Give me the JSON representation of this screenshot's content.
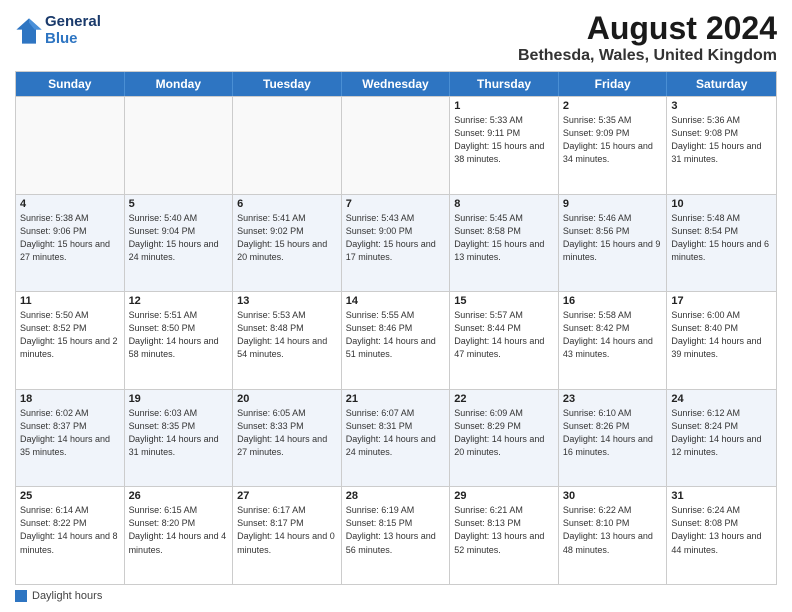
{
  "header": {
    "logo_line1": "General",
    "logo_line2": "Blue",
    "main_title": "August 2024",
    "subtitle": "Bethesda, Wales, United Kingdom"
  },
  "calendar": {
    "days_of_week": [
      "Sunday",
      "Monday",
      "Tuesday",
      "Wednesday",
      "Thursday",
      "Friday",
      "Saturday"
    ],
    "weeks": [
      [
        {
          "day": "",
          "empty": true
        },
        {
          "day": "",
          "empty": true
        },
        {
          "day": "",
          "empty": true
        },
        {
          "day": "",
          "empty": true
        },
        {
          "day": "1",
          "sunrise": "Sunrise: 5:33 AM",
          "sunset": "Sunset: 9:11 PM",
          "daylight": "Daylight: 15 hours and 38 minutes."
        },
        {
          "day": "2",
          "sunrise": "Sunrise: 5:35 AM",
          "sunset": "Sunset: 9:09 PM",
          "daylight": "Daylight: 15 hours and 34 minutes."
        },
        {
          "day": "3",
          "sunrise": "Sunrise: 5:36 AM",
          "sunset": "Sunset: 9:08 PM",
          "daylight": "Daylight: 15 hours and 31 minutes."
        }
      ],
      [
        {
          "day": "4",
          "sunrise": "Sunrise: 5:38 AM",
          "sunset": "Sunset: 9:06 PM",
          "daylight": "Daylight: 15 hours and 27 minutes."
        },
        {
          "day": "5",
          "sunrise": "Sunrise: 5:40 AM",
          "sunset": "Sunset: 9:04 PM",
          "daylight": "Daylight: 15 hours and 24 minutes."
        },
        {
          "day": "6",
          "sunrise": "Sunrise: 5:41 AM",
          "sunset": "Sunset: 9:02 PM",
          "daylight": "Daylight: 15 hours and 20 minutes."
        },
        {
          "day": "7",
          "sunrise": "Sunrise: 5:43 AM",
          "sunset": "Sunset: 9:00 PM",
          "daylight": "Daylight: 15 hours and 17 minutes."
        },
        {
          "day": "8",
          "sunrise": "Sunrise: 5:45 AM",
          "sunset": "Sunset: 8:58 PM",
          "daylight": "Daylight: 15 hours and 13 minutes."
        },
        {
          "day": "9",
          "sunrise": "Sunrise: 5:46 AM",
          "sunset": "Sunset: 8:56 PM",
          "daylight": "Daylight: 15 hours and 9 minutes."
        },
        {
          "day": "10",
          "sunrise": "Sunrise: 5:48 AM",
          "sunset": "Sunset: 8:54 PM",
          "daylight": "Daylight: 15 hours and 6 minutes."
        }
      ],
      [
        {
          "day": "11",
          "sunrise": "Sunrise: 5:50 AM",
          "sunset": "Sunset: 8:52 PM",
          "daylight": "Daylight: 15 hours and 2 minutes."
        },
        {
          "day": "12",
          "sunrise": "Sunrise: 5:51 AM",
          "sunset": "Sunset: 8:50 PM",
          "daylight": "Daylight: 14 hours and 58 minutes."
        },
        {
          "day": "13",
          "sunrise": "Sunrise: 5:53 AM",
          "sunset": "Sunset: 8:48 PM",
          "daylight": "Daylight: 14 hours and 54 minutes."
        },
        {
          "day": "14",
          "sunrise": "Sunrise: 5:55 AM",
          "sunset": "Sunset: 8:46 PM",
          "daylight": "Daylight: 14 hours and 51 minutes."
        },
        {
          "day": "15",
          "sunrise": "Sunrise: 5:57 AM",
          "sunset": "Sunset: 8:44 PM",
          "daylight": "Daylight: 14 hours and 47 minutes."
        },
        {
          "day": "16",
          "sunrise": "Sunrise: 5:58 AM",
          "sunset": "Sunset: 8:42 PM",
          "daylight": "Daylight: 14 hours and 43 minutes."
        },
        {
          "day": "17",
          "sunrise": "Sunrise: 6:00 AM",
          "sunset": "Sunset: 8:40 PM",
          "daylight": "Daylight: 14 hours and 39 minutes."
        }
      ],
      [
        {
          "day": "18",
          "sunrise": "Sunrise: 6:02 AM",
          "sunset": "Sunset: 8:37 PM",
          "daylight": "Daylight: 14 hours and 35 minutes."
        },
        {
          "day": "19",
          "sunrise": "Sunrise: 6:03 AM",
          "sunset": "Sunset: 8:35 PM",
          "daylight": "Daylight: 14 hours and 31 minutes."
        },
        {
          "day": "20",
          "sunrise": "Sunrise: 6:05 AM",
          "sunset": "Sunset: 8:33 PM",
          "daylight": "Daylight: 14 hours and 27 minutes."
        },
        {
          "day": "21",
          "sunrise": "Sunrise: 6:07 AM",
          "sunset": "Sunset: 8:31 PM",
          "daylight": "Daylight: 14 hours and 24 minutes."
        },
        {
          "day": "22",
          "sunrise": "Sunrise: 6:09 AM",
          "sunset": "Sunset: 8:29 PM",
          "daylight": "Daylight: 14 hours and 20 minutes."
        },
        {
          "day": "23",
          "sunrise": "Sunrise: 6:10 AM",
          "sunset": "Sunset: 8:26 PM",
          "daylight": "Daylight: 14 hours and 16 minutes."
        },
        {
          "day": "24",
          "sunrise": "Sunrise: 6:12 AM",
          "sunset": "Sunset: 8:24 PM",
          "daylight": "Daylight: 14 hours and 12 minutes."
        }
      ],
      [
        {
          "day": "25",
          "sunrise": "Sunrise: 6:14 AM",
          "sunset": "Sunset: 8:22 PM",
          "daylight": "Daylight: 14 hours and 8 minutes."
        },
        {
          "day": "26",
          "sunrise": "Sunrise: 6:15 AM",
          "sunset": "Sunset: 8:20 PM",
          "daylight": "Daylight: 14 hours and 4 minutes."
        },
        {
          "day": "27",
          "sunrise": "Sunrise: 6:17 AM",
          "sunset": "Sunset: 8:17 PM",
          "daylight": "Daylight: 14 hours and 0 minutes."
        },
        {
          "day": "28",
          "sunrise": "Sunrise: 6:19 AM",
          "sunset": "Sunset: 8:15 PM",
          "daylight": "Daylight: 13 hours and 56 minutes."
        },
        {
          "day": "29",
          "sunrise": "Sunrise: 6:21 AM",
          "sunset": "Sunset: 8:13 PM",
          "daylight": "Daylight: 13 hours and 52 minutes."
        },
        {
          "day": "30",
          "sunrise": "Sunrise: 6:22 AM",
          "sunset": "Sunset: 8:10 PM",
          "daylight": "Daylight: 13 hours and 48 minutes."
        },
        {
          "day": "31",
          "sunrise": "Sunrise: 6:24 AM",
          "sunset": "Sunset: 8:08 PM",
          "daylight": "Daylight: 13 hours and 44 minutes."
        }
      ]
    ]
  },
  "footer": {
    "label": "Daylight hours"
  }
}
